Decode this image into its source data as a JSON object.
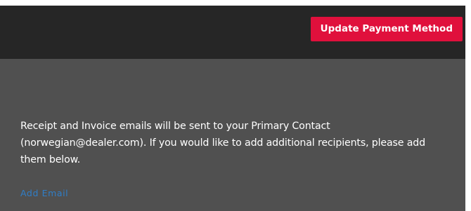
{
  "header": {
    "update_payment_button_label": "Update Payment Method"
  },
  "billing_notice": {
    "line_1": "Receipt and Invoice emails will be sent to your Primary Contact",
    "line_2": "(norwegian@dealer.com). If you would like to add additional recipients, please add",
    "line_3": "them below."
  },
  "add_email": {
    "link_label": "Add Email"
  },
  "colors": {
    "header_background": "#262626",
    "panel_background": "#505050",
    "accent_button": "#e0103c",
    "link": "#2f7ec8",
    "text": "#ffffff"
  }
}
